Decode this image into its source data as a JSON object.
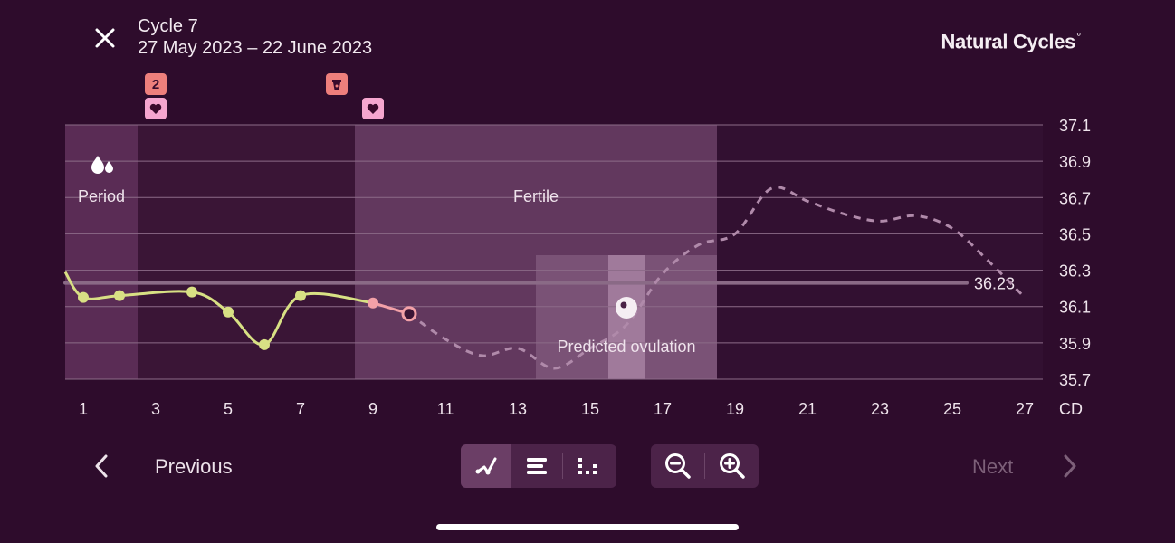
{
  "header": {
    "close_icon": "close-icon",
    "cycle_title": "Cycle 7",
    "cycle_dates": "27 May 2023 – 22 June 2023",
    "brand_name": "Natural Cycles",
    "brand_mark": "°"
  },
  "markers": [
    {
      "day": 3,
      "type": "count",
      "text": "2"
    },
    {
      "day": 3,
      "type": "heart",
      "icon": "heart-icon"
    },
    {
      "day": 8,
      "type": "cup",
      "icon": "cup-icon"
    },
    {
      "day": 9,
      "type": "heart",
      "icon": "heart-icon"
    }
  ],
  "zones": {
    "period_label": "Period",
    "period_icon": "blood-drops-icon",
    "fertile_label": "Fertile",
    "ovulation_label": "Predicted ovulation",
    "ovulation_icon": "egg-icon"
  },
  "chart_data": {
    "type": "line",
    "x_label": "CD",
    "x_ticks": [
      1,
      3,
      5,
      7,
      9,
      11,
      13,
      15,
      17,
      19,
      21,
      23,
      25,
      27
    ],
    "y_ticks": [
      35.7,
      35.9,
      36.1,
      36.3,
      36.5,
      36.7,
      36.9,
      37.1
    ],
    "xlim": [
      0.5,
      27.5
    ],
    "ylim": [
      35.7,
      37.1
    ],
    "coverline": 36.23,
    "coverline_label": "36.23",
    "period_days": [
      1,
      2
    ],
    "fertile_days": [
      9,
      18
    ],
    "predicted_ovulation_range": [
      14,
      18
    ],
    "ovulation_day": 16,
    "measured": [
      {
        "day": 0.5,
        "temp": 36.29
      },
      {
        "day": 1,
        "temp": 36.15
      },
      {
        "day": 2,
        "temp": 36.16
      },
      {
        "day": 4,
        "temp": 36.18
      },
      {
        "day": 5,
        "temp": 36.07
      },
      {
        "day": 6,
        "temp": 35.89
      },
      {
        "day": 7,
        "temp": 36.16
      },
      {
        "day": 9,
        "temp": 36.12
      }
    ],
    "today": {
      "day": 10,
      "temp": 36.06
    },
    "predicted": [
      {
        "day": 10,
        "temp": 36.06
      },
      {
        "day": 11,
        "temp": 35.92
      },
      {
        "day": 12,
        "temp": 35.83
      },
      {
        "day": 13,
        "temp": 35.87
      },
      {
        "day": 14,
        "temp": 35.76
      },
      {
        "day": 15,
        "temp": 35.87
      },
      {
        "day": 16,
        "temp": 36.0
      },
      {
        "day": 17,
        "temp": 36.28
      },
      {
        "day": 18,
        "temp": 36.44
      },
      {
        "day": 19,
        "temp": 36.5
      },
      {
        "day": 20,
        "temp": 36.75
      },
      {
        "day": 21,
        "temp": 36.68
      },
      {
        "day": 22,
        "temp": 36.61
      },
      {
        "day": 23,
        "temp": 36.57
      },
      {
        "day": 24,
        "temp": 36.6
      },
      {
        "day": 25,
        "temp": 36.53
      },
      {
        "day": 26,
        "temp": 36.35
      },
      {
        "day": 27,
        "temp": 36.15
      }
    ],
    "colors": {
      "measured": "#d8e084",
      "latest": "#f3a1a8",
      "predicted": "#b08aaa",
      "coverline": "#8a6a86"
    }
  },
  "footer": {
    "previous_label": "Previous",
    "next_label": "Next",
    "view_buttons": [
      "graph-view-icon",
      "list-view-icon",
      "grid-view-icon"
    ],
    "zoom_buttons": [
      "zoom-out-icon",
      "zoom-in-icon"
    ]
  }
}
